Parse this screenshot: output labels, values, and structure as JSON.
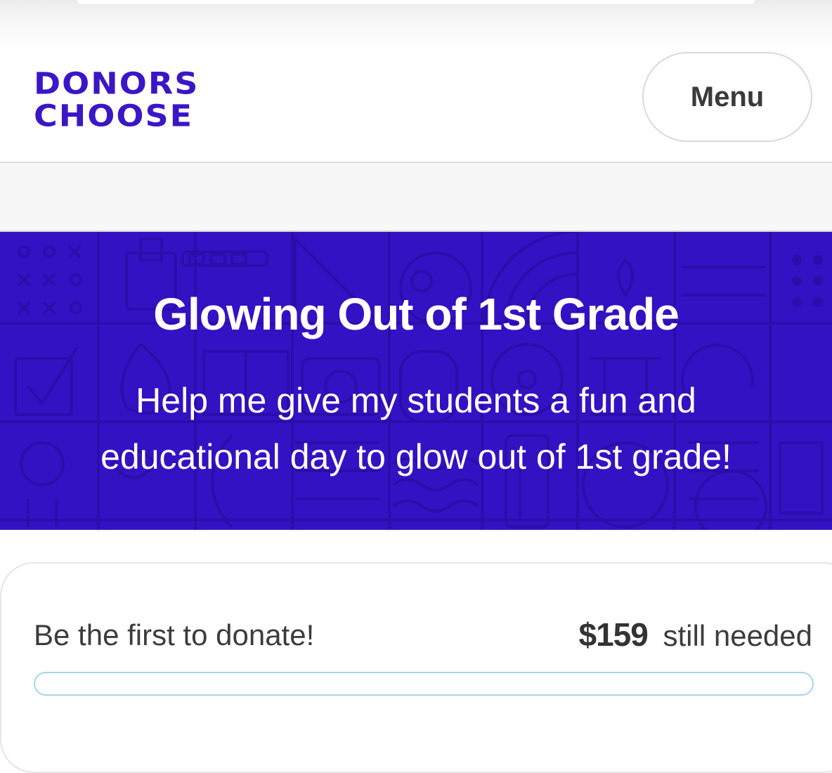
{
  "header": {
    "logo_line1": "DONORS",
    "logo_line2": "CHOOSE",
    "menu_label": "Menu"
  },
  "hero": {
    "title": "Glowing Out of 1st Grade",
    "subtitle_line1": "Help me give my students a fun and",
    "subtitle_line2": "educational day to glow out of 1st grade!"
  },
  "donation": {
    "prompt": "Be the first to donate!",
    "amount": "$159",
    "amount_suffix": "still needed",
    "progress_fraction": 0
  },
  "colors": {
    "brand_purple": "#3312c4",
    "logo_purple": "#3a16c7",
    "progress_border": "#a6d6e6"
  }
}
